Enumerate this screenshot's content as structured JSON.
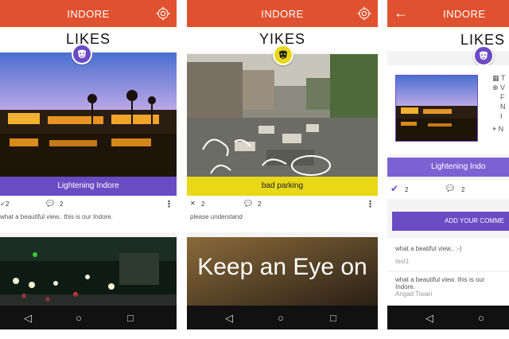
{
  "screens": [
    {
      "appbar_title": "INDORE",
      "section_title": "LIKES",
      "post": {
        "title": "Lightening Indore",
        "likes": "2",
        "comments_count": "2",
        "comment": "what a beautiful view.. this is our Indore."
      }
    },
    {
      "appbar_title": "INDORE",
      "section_title": "YIKES",
      "post": {
        "title": "bad parking",
        "handwriting": "Bad Parking",
        "likes": "2",
        "comments_count": "2",
        "comment": "please understand"
      },
      "next_post_text": "Keep an Eye on"
    },
    {
      "appbar_title": "INDORE",
      "section_title": "LIKES",
      "post_title": "Lightening Indo",
      "likes": "2",
      "comments_count": "2",
      "detail_letters": [
        "T",
        "V",
        "F",
        "N",
        "I",
        "N"
      ],
      "add_comment_button": "ADD YOUR COMME",
      "comments": [
        {
          "text": "what a beatiful view.. :-)",
          "author": "test1"
        },
        {
          "text": "what a beautiful view. this is our Indore.",
          "author": "Angad Tiwari"
        }
      ]
    }
  ],
  "colors": {
    "appbar": "#e0522f",
    "likes_purple": "#6b4bc4",
    "yikes_yellow": "#e8d818"
  },
  "icons": [
    "settings-gear-icon",
    "back-arrow-icon",
    "happy-mask-icon",
    "sad-mask-icon",
    "like-icon",
    "comment-icon",
    "more-icon",
    "nav-back-icon",
    "nav-home-icon",
    "nav-recents-icon",
    "checkmark-icon",
    "cross-icon"
  ]
}
